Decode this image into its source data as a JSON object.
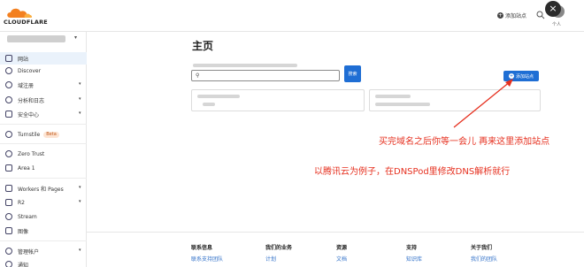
{
  "brand": {
    "logo_text": "CLOUDFLARE",
    "logo_color": "#f38020"
  },
  "topbar": {
    "add_site_label": "添加站点",
    "user_label": "个人",
    "close_glyph": "×"
  },
  "sidebar": {
    "items": [
      {
        "label": "网站",
        "icon": "website-icon",
        "active": true
      },
      {
        "label": "Discover",
        "icon": "discover-icon"
      },
      {
        "label": "域注册",
        "icon": "domain-registration-icon",
        "caret": "▾"
      },
      {
        "label": "分析和日志",
        "icon": "analytics-icon",
        "caret": "▾"
      },
      {
        "label": "安全中心",
        "icon": "security-icon",
        "caret": "▾"
      },
      {
        "label": "Turnstile",
        "icon": "turnstile-icon",
        "badge": "Beta"
      },
      {
        "label": "Zero Trust",
        "icon": "zero-trust-icon"
      },
      {
        "label": "Area 1",
        "icon": "area1-icon"
      },
      {
        "label": "Workers 和 Pages",
        "icon": "workers-icon",
        "caret": "▾"
      },
      {
        "label": "R2",
        "icon": "r2-icon",
        "caret": "▾"
      },
      {
        "label": "Stream",
        "icon": "stream-icon"
      },
      {
        "label": "图像",
        "icon": "images-icon"
      },
      {
        "label": "管理帐户",
        "icon": "manage-account-icon",
        "caret": "▾"
      },
      {
        "label": "通知",
        "icon": "notifications-icon"
      }
    ]
  },
  "main": {
    "title": "主页",
    "search_placeholder": "",
    "search_button_label": "搜索",
    "add_site_button_label": "添加站点"
  },
  "annotations": {
    "note1": "买完域名之后你等一会儿 再来这里添加站点",
    "note2": "以腾讯云为例子，在DNSPod里修改DNS解析就行",
    "color": "#e6301f"
  },
  "footer": {
    "columns": [
      {
        "heading": "联系信息",
        "link": "联系支持团队"
      },
      {
        "heading": "我们的业务",
        "link": "计划"
      },
      {
        "heading": "资源",
        "link": "文档"
      },
      {
        "heading": "支持",
        "link": "知识库"
      },
      {
        "heading": "关于我们",
        "link": "我们的团队"
      }
    ]
  }
}
